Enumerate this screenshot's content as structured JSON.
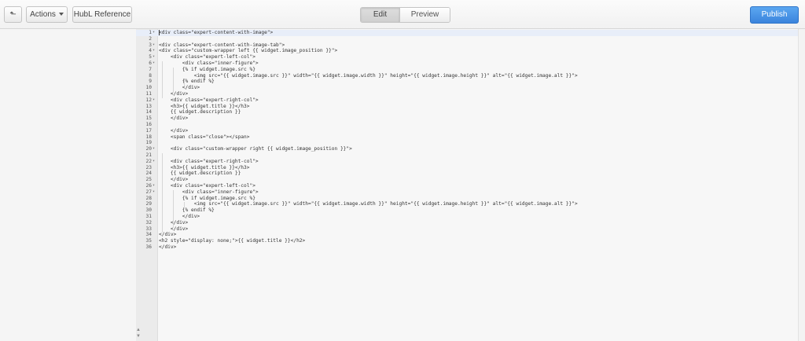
{
  "toolbar": {
    "back_icon": "back-arrow-icon",
    "back_glyph": "⬑",
    "actions_label": "Actions",
    "hubl_label": "HubL Reference",
    "tab_edit": "Edit",
    "tab_preview": "Preview",
    "publish_label": "Publish"
  },
  "editor": {
    "scroll_up": "▲",
    "scroll_down": "▼",
    "lines": [
      {
        "n": "1",
        "fold": true,
        "text": "<div class=\"expert-content-with-image\">"
      },
      {
        "n": "2",
        "fold": false,
        "text": ""
      },
      {
        "n": "3",
        "fold": true,
        "text": "<div class=\"expert-content-with-image-tab\">"
      },
      {
        "n": "4",
        "fold": true,
        "text": "<div class=\"custom-wrapper left {{ widget.image_position }}\">"
      },
      {
        "n": "5",
        "fold": true,
        "text": "    <div class=\"expert-left-col\">"
      },
      {
        "n": "6",
        "fold": true,
        "text": "        <div class=\"inner-figure\">"
      },
      {
        "n": "7",
        "fold": false,
        "text": "        {% if widget.image.src %}"
      },
      {
        "n": "8",
        "fold": false,
        "text": "            <img src=\"{{ widget.image.src }}\" width=\"{{ widget.image.width }}\" height=\"{{ widget.image.height }}\" alt=\"{{ widget.image.alt }}\">"
      },
      {
        "n": "9",
        "fold": false,
        "text": "        {% endif %}"
      },
      {
        "n": "10",
        "fold": false,
        "text": "        </div>"
      },
      {
        "n": "11",
        "fold": false,
        "text": "    </div>"
      },
      {
        "n": "12",
        "fold": true,
        "text": "    <div class=\"expert-right-col\">"
      },
      {
        "n": "13",
        "fold": false,
        "text": "    <h3>{{ widget.title }}</h3>"
      },
      {
        "n": "14",
        "fold": false,
        "text": "    {{ widget.description }}"
      },
      {
        "n": "15",
        "fold": false,
        "text": "    </div>"
      },
      {
        "n": "16",
        "fold": false,
        "text": ""
      },
      {
        "n": "17",
        "fold": false,
        "text": "    </div>"
      },
      {
        "n": "18",
        "fold": false,
        "text": "    <span class=\"close\"></span>"
      },
      {
        "n": "19",
        "fold": false,
        "text": ""
      },
      {
        "n": "20",
        "fold": true,
        "text": "    <div class=\"custom-wrapper right {{ widget.image_position }}\">"
      },
      {
        "n": "21",
        "fold": false,
        "text": ""
      },
      {
        "n": "22",
        "fold": true,
        "text": "    <div class=\"expert-right-col\">"
      },
      {
        "n": "23",
        "fold": false,
        "text": "    <h3>{{ widget.title }}</h3>"
      },
      {
        "n": "24",
        "fold": false,
        "text": "    {{ widget.description }}"
      },
      {
        "n": "25",
        "fold": false,
        "text": "    </div>"
      },
      {
        "n": "26",
        "fold": true,
        "text": "    <div class=\"expert-left-col\">"
      },
      {
        "n": "27",
        "fold": true,
        "text": "        <div class=\"inner-figure\">"
      },
      {
        "n": "28",
        "fold": false,
        "text": "        {% if widget.image.src %}"
      },
      {
        "n": "29",
        "fold": false,
        "text": "            <img src=\"{{ widget.image.src }}\" width=\"{{ widget.image.width }}\" height=\"{{ widget.image.height }}\" alt=\"{{ widget.image.alt }}\">"
      },
      {
        "n": "30",
        "fold": false,
        "text": "        {% endif %}"
      },
      {
        "n": "31",
        "fold": false,
        "text": "        </div>"
      },
      {
        "n": "32",
        "fold": false,
        "text": "    </div>"
      },
      {
        "n": "33",
        "fold": false,
        "text": "    </div>"
      },
      {
        "n": "34",
        "fold": false,
        "text": "</div>"
      },
      {
        "n": "35",
        "fold": false,
        "text": "<h2 style=\"display: none;\">{{ widget.title }}</h2>"
      },
      {
        "n": "36",
        "fold": false,
        "text": "</div>"
      }
    ]
  },
  "colors": {
    "accent": "#3b84dc",
    "active_line": "#e8eef9"
  }
}
